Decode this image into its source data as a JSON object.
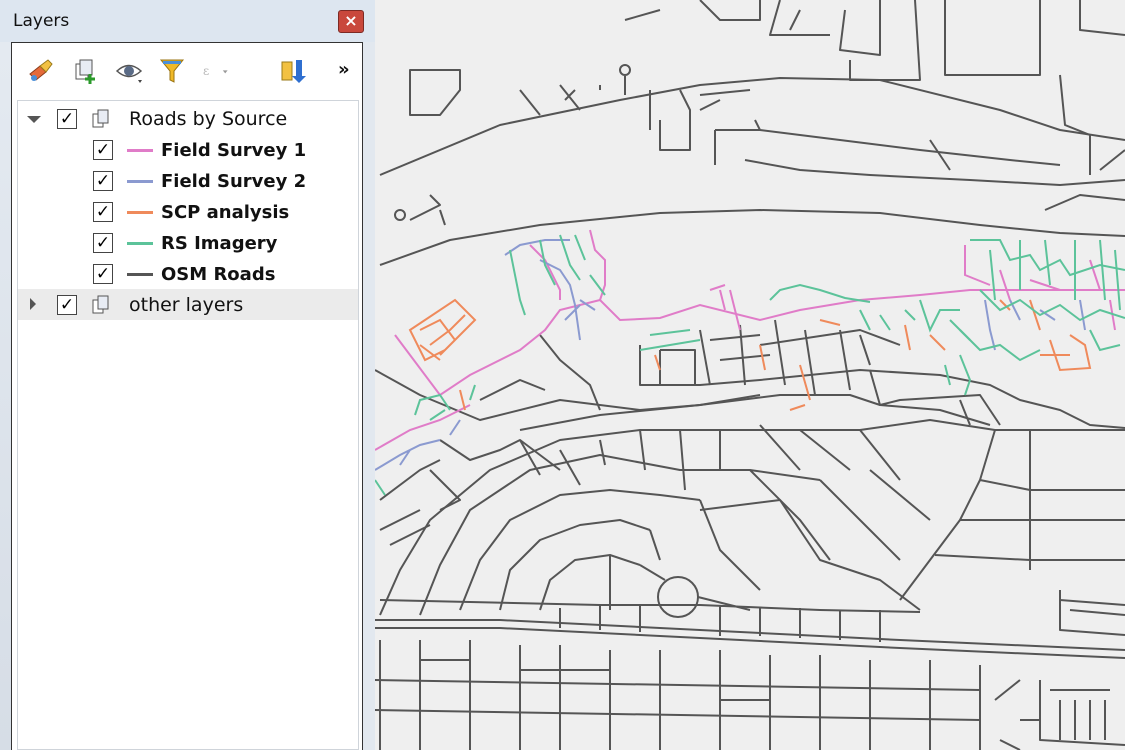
{
  "window": {
    "title": "Layers",
    "close": "×"
  },
  "toolbar": {
    "buttons": [
      {
        "name": "style-manager-icon"
      },
      {
        "name": "add-group-icon"
      },
      {
        "name": "visibility-icon"
      },
      {
        "name": "filter-legend-icon"
      },
      {
        "name": "filter-expression-icon"
      },
      {
        "name": "expand-collapse-icon"
      }
    ],
    "more": "»"
  },
  "tree": {
    "group1": {
      "label": "Roads by Source",
      "checked": "✓",
      "expanded": true
    },
    "items": [
      {
        "label": "Field Survey 1",
        "color": "#e07cc8",
        "check": "✓"
      },
      {
        "label": "Field Survey 2",
        "color": "#8b9ad0",
        "check": "✓"
      },
      {
        "label": "SCP analysis",
        "color": "#ef8a5b",
        "check": "✓"
      },
      {
        "label": "RS Imagery",
        "color": "#5cc39a",
        "check": "✓"
      },
      {
        "label": "OSM Roads",
        "color": "#555555",
        "check": "✓"
      }
    ],
    "group2": {
      "label": "other layers",
      "checked": "✓",
      "expanded": false
    }
  },
  "map": {
    "background": "#efefef",
    "road_color": "#555555"
  }
}
